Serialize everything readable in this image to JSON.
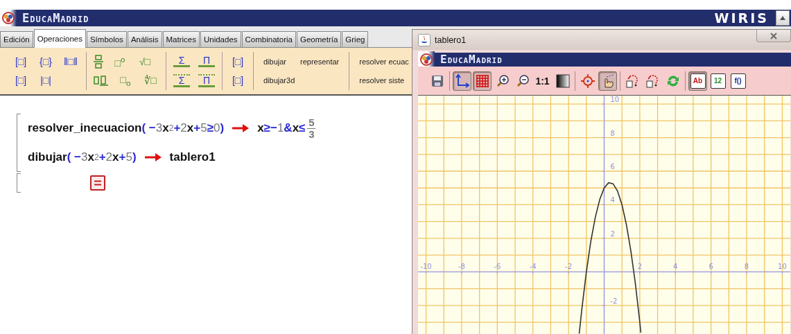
{
  "app": {
    "brand": "EducaMadrid",
    "product": "WIRIS"
  },
  "tabs": [
    {
      "label": "Edición",
      "selected": false
    },
    {
      "label": "Operaciones",
      "selected": true
    },
    {
      "label": "Símbolos",
      "selected": false
    },
    {
      "label": "Análisis",
      "selected": false
    },
    {
      "label": "Matrices",
      "selected": false
    },
    {
      "label": "Unidades",
      "selected": false
    },
    {
      "label": "Combinatoria",
      "selected": false
    },
    {
      "label": "Geometría",
      "selected": false
    },
    {
      "label": "Grieg",
      "selected": false
    }
  ],
  "toolbar": {
    "groups": [
      {
        "kind": "delimiters",
        "rows": [
          [
            {
              "kind": "glyph",
              "text": "[□]"
            },
            {
              "kind": "glyph",
              "text": "{□}"
            },
            {
              "kind": "glyph",
              "text": "‖□‖"
            }
          ],
          [
            {
              "kind": "glyph",
              "text": "[□]"
            },
            {
              "kind": "glyph",
              "text": "|□|"
            }
          ]
        ]
      },
      {
        "kind": "operators",
        "rows": [
          [
            {
              "kind": "fraction"
            },
            {
              "kind": "glyph",
              "text": "□$^{o}$"
            },
            {
              "kind": "glyph",
              "text": "√□"
            }
          ],
          [
            {
              "kind": "mixed-fraction"
            },
            {
              "kind": "glyph",
              "text": "□$_{o}$"
            },
            {
              "kind": "glyph",
              "text": "∜□"
            }
          ]
        ]
      },
      {
        "kind": "bigops",
        "rows": [
          [
            {
              "kind": "bigop",
              "text": "Σ"
            },
            {
              "kind": "bigop",
              "text": "Π"
            }
          ],
          [
            {
              "kind": "bigop-limits",
              "text": "Σ"
            },
            {
              "kind": "bigop-limits",
              "text": "Π"
            }
          ]
        ]
      },
      {
        "kind": "matrix",
        "rows": [
          [
            {
              "kind": "glyph",
              "text": "[□]"
            }
          ],
          [
            {
              "kind": "glyph",
              "text": "[□]"
            }
          ]
        ]
      },
      {
        "kind": "commands",
        "rows": [
          [
            {
              "kind": "command",
              "text": "dibujar"
            },
            {
              "kind": "command",
              "text": "representar"
            }
          ],
          [
            {
              "kind": "command",
              "text": "dibujar3d"
            }
          ]
        ]
      },
      {
        "kind": "commands",
        "rows": [
          [
            {
              "kind": "command",
              "text": "resolver ecuac"
            }
          ],
          [
            {
              "kind": "command",
              "text": "resolver siste"
            }
          ]
        ]
      }
    ]
  },
  "worksheet": {
    "blocks": [
      {
        "lines": [
          {
            "input": [
              {
                "kind": "name",
                "t": "resolver_inecuacion"
              },
              {
                "kind": "op",
                "t": "("
              },
              {
                "kind": "op",
                "t": " −"
              },
              {
                "kind": "num",
                "t": "3"
              },
              {
                "kind": "var",
                "t": "x"
              },
              {
                "kind": "sup",
                "t": "2"
              },
              {
                "kind": "op",
                "t": "+"
              },
              {
                "kind": "num",
                "t": "2"
              },
              {
                "kind": "var",
                "t": "x"
              },
              {
                "kind": "op",
                "t": "+"
              },
              {
                "kind": "num",
                "t": "5"
              },
              {
                "kind": "op",
                "t": "≥"
              },
              {
                "kind": "num",
                "t": "0"
              },
              {
                "kind": "op",
                "t": ")"
              }
            ],
            "result": [
              {
                "kind": "var",
                "t": "x"
              },
              {
                "kind": "op",
                "t": "≥"
              },
              {
                "kind": "op",
                "t": "−"
              },
              {
                "kind": "num",
                "t": "1"
              },
              {
                "kind": "op",
                "t": "&"
              },
              {
                "kind": "var",
                "t": "x"
              },
              {
                "kind": "op",
                "t": "≤"
              },
              {
                "kind": "frac",
                "num": "5",
                "den": "3"
              }
            ]
          },
          {
            "input": [
              {
                "kind": "name",
                "t": "dibujar"
              },
              {
                "kind": "op",
                "t": "("
              },
              {
                "kind": "op",
                "t": " −"
              },
              {
                "kind": "num",
                "t": "3"
              },
              {
                "kind": "var",
                "t": "x"
              },
              {
                "kind": "sup",
                "t": "2"
              },
              {
                "kind": "op",
                "t": "+"
              },
              {
                "kind": "num",
                "t": "2"
              },
              {
                "kind": "var",
                "t": "x"
              },
              {
                "kind": "op",
                "t": "+"
              },
              {
                "kind": "num",
                "t": "5"
              },
              {
                "kind": "op",
                "t": ")"
              }
            ],
            "result": [
              {
                "kind": "name",
                "t": "tablero1"
              }
            ]
          }
        ]
      },
      {
        "lines": [
          {
            "kind": "empty"
          }
        ]
      }
    ]
  },
  "board": {
    "title": "tablero1",
    "brand": "EducaMadrid",
    "tools": [
      [
        {
          "kind": "save",
          "pressed": false
        }
      ],
      [
        {
          "kind": "axes",
          "pressed": true
        },
        {
          "kind": "grid",
          "pressed": true
        },
        {
          "kind": "zoom-in",
          "pressed": false
        },
        {
          "kind": "zoom-out",
          "pressed": false
        },
        {
          "kind": "text",
          "label": "1:1",
          "pressed": false
        },
        {
          "kind": "gradient",
          "pressed": false
        }
      ],
      [
        {
          "kind": "target",
          "pressed": false
        },
        {
          "kind": "pointer",
          "pressed": true
        }
      ],
      [
        {
          "kind": "undo",
          "pressed": false
        },
        {
          "kind": "redo",
          "pressed": false
        },
        {
          "kind": "refresh",
          "pressed": false
        }
      ],
      [
        {
          "kind": "doc",
          "label": "Ab",
          "pressed": true
        },
        {
          "kind": "doc",
          "label": "12",
          "pressed": false
        },
        {
          "kind": "doc",
          "label": "f()",
          "pressed": false
        }
      ]
    ],
    "chart_data": {
      "type": "line",
      "grid": true,
      "xlim": [
        -10.45,
        10.45
      ],
      "ylim": [
        -3.7,
        10.5
      ],
      "xticks": [
        -10,
        -8,
        -6,
        -4,
        -2,
        2,
        4,
        6,
        8,
        10
      ],
      "yticks": [
        -2,
        2,
        4,
        6,
        8,
        10
      ],
      "x": [
        -1.4,
        -1.25,
        -1,
        -0.75,
        -0.5,
        -0.25,
        0,
        0.25,
        0.5,
        0.75,
        1,
        1.25,
        1.5,
        1.75,
        2,
        2.06
      ],
      "series": [
        {
          "color": "#333333",
          "values": [
            -3.68,
            -2.19,
            0,
            1.81,
            3.25,
            4.31,
            5,
            5.31,
            5.25,
            4.81,
            4,
            2.81,
            1.25,
            -0.69,
            -3,
            -3.61
          ]
        }
      ]
    }
  }
}
